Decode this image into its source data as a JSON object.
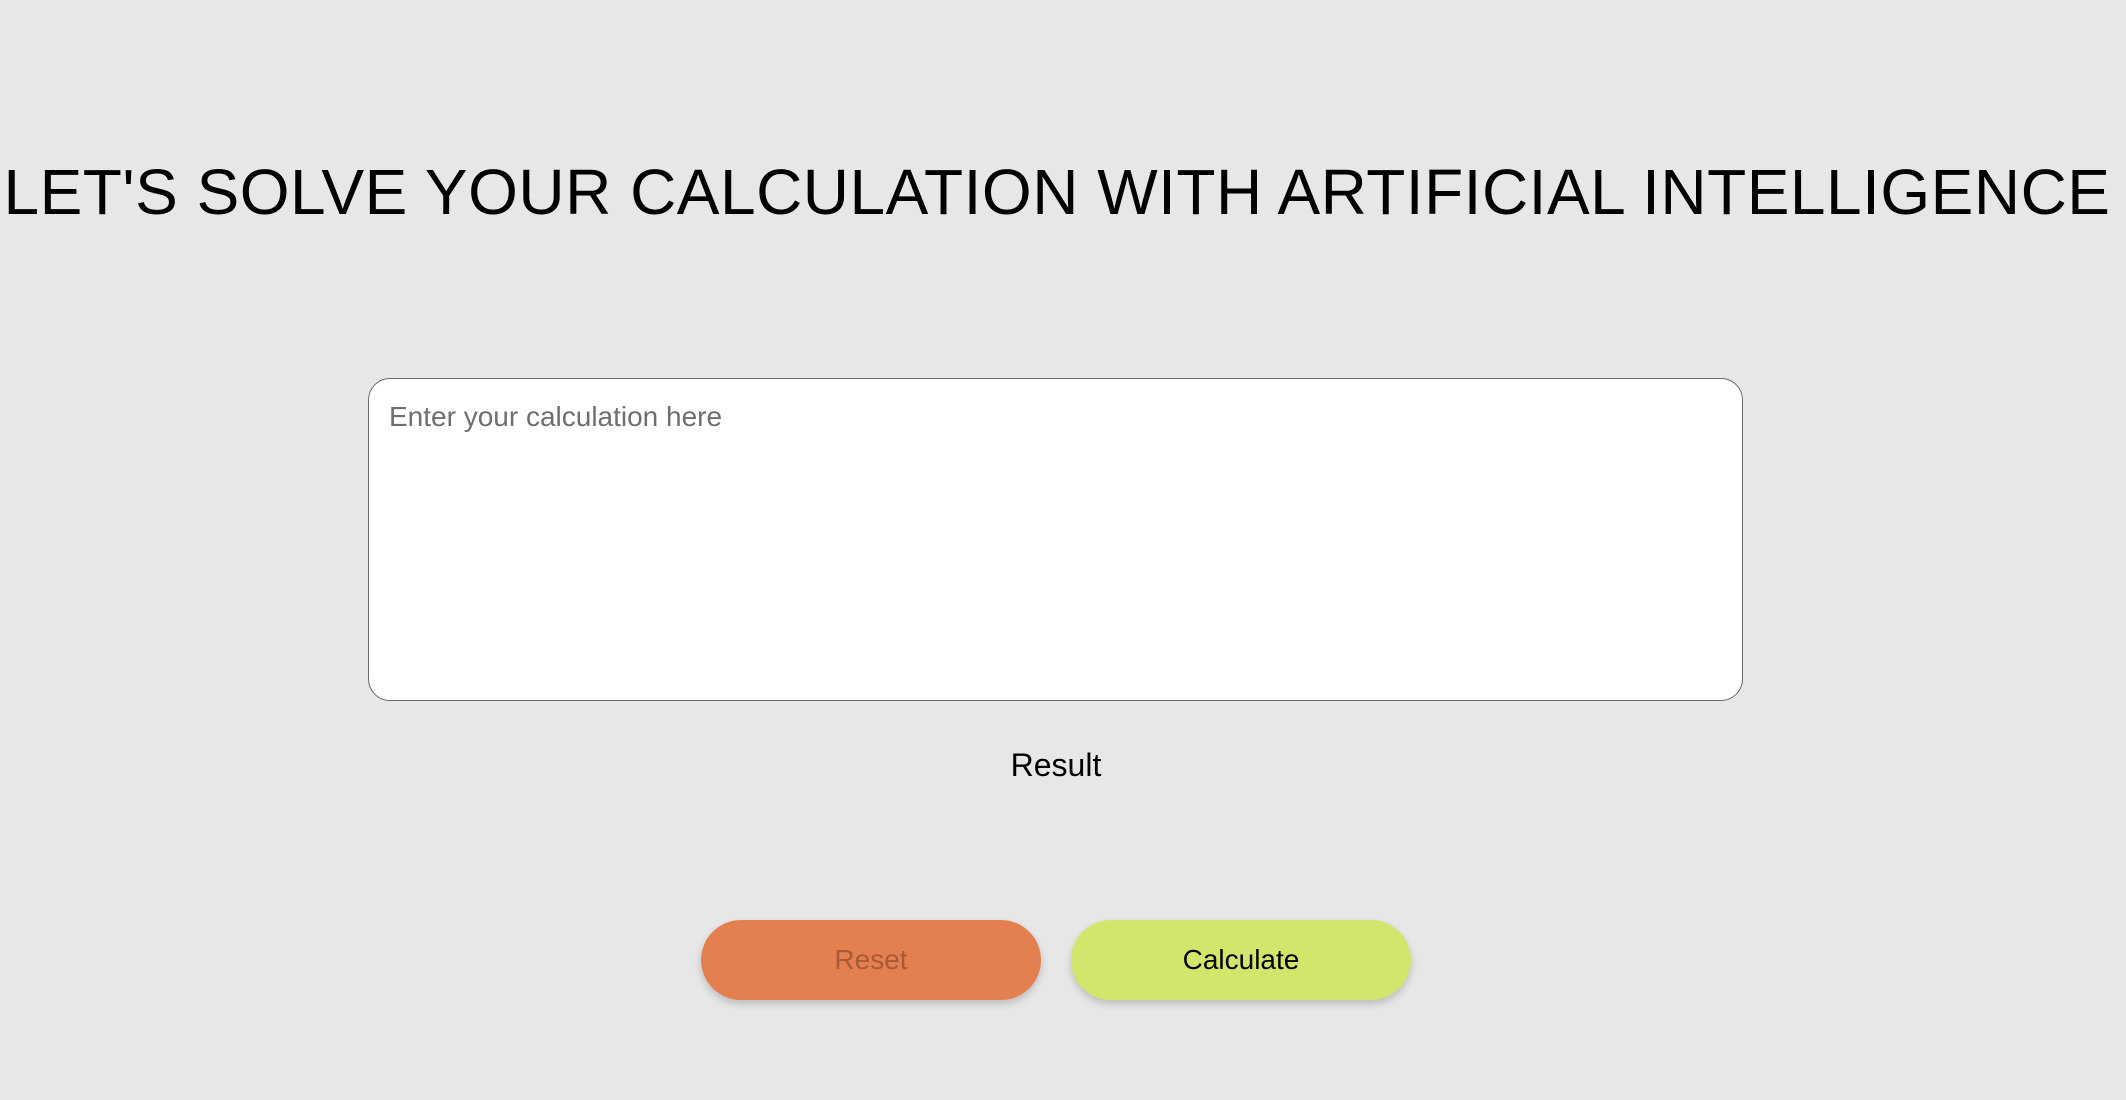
{
  "header": {
    "title": "LET'S SOLVE YOUR CALCULATION WITH ARTIFICIAL INTELLIGENCE"
  },
  "calculator": {
    "input_value": "",
    "input_placeholder": "Enter your calculation here",
    "result_label": "Result"
  },
  "actions": {
    "reset_label": "Reset",
    "calculate_label": "Calculate"
  },
  "colors": {
    "background": "#e7e7e7",
    "reset_button": "#e4804f",
    "calculate_button": "#d1e66a"
  }
}
